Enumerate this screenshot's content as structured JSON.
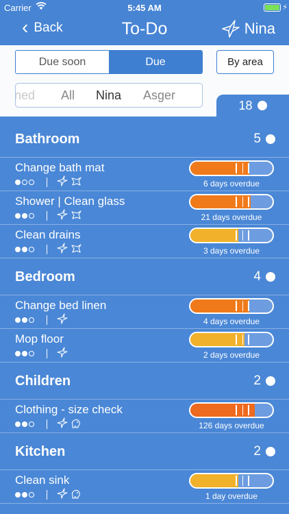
{
  "status": {
    "carrier": "Carrier",
    "time": "5:45 AM"
  },
  "nav": {
    "back_label": "Back",
    "title": "To-Do",
    "user_label": "Nina"
  },
  "filters": {
    "segments": [
      "Due soon",
      "Due"
    ],
    "active_segment": "Due",
    "area_button": "By area",
    "people": [
      "ned",
      "All",
      "Nina",
      "Asger"
    ],
    "selected_person": "Nina"
  },
  "total_count": "18",
  "colors": {
    "accent": "#3f7fd1",
    "background": "#4a87d6",
    "overdue_orange": "#f07a1a",
    "due_yellow": "#f2b12a"
  },
  "sections": [
    {
      "name": "Bathroom",
      "count": "5",
      "tasks": [
        {
          "title": "Change bath mat",
          "priority": 1,
          "assignees": [
            "bird-icon",
            "fox-icon"
          ],
          "overdue": "6 days overdue",
          "progress": 0.72,
          "color": "#f07a1a"
        },
        {
          "title": "Shower | Clean glass",
          "priority": 2,
          "assignees": [
            "bird-icon",
            "fox-icon"
          ],
          "overdue": "21 days overdue",
          "progress": 0.73,
          "color": "#f07a1a"
        },
        {
          "title": "Clean drains",
          "priority": 2,
          "assignees": [
            "bird-icon",
            "fox-icon"
          ],
          "overdue": "3 days overdue",
          "progress": 0.58,
          "color": "#f2b12a"
        }
      ]
    },
    {
      "name": "Bedroom",
      "count": "4",
      "tasks": [
        {
          "title": "Change bed linen",
          "priority": 2,
          "assignees": [
            "bird-icon"
          ],
          "overdue": "4 days overdue",
          "progress": 0.72,
          "color": "#f07a1a"
        },
        {
          "title": "Mop floor",
          "priority": 2,
          "assignees": [
            "bird-icon"
          ],
          "overdue": "2 days overdue",
          "progress": 0.66,
          "color": "#f2b12a"
        }
      ]
    },
    {
      "name": "Children",
      "count": "2",
      "tasks": [
        {
          "title": "Clothing - size check",
          "priority": 2,
          "assignees": [
            "bird-icon",
            "elephant-icon"
          ],
          "overdue": "126 days overdue",
          "progress": 0.78,
          "color": "#ee6a1e"
        }
      ]
    },
    {
      "name": "Kitchen",
      "count": "2",
      "tasks": [
        {
          "title": "Clean sink",
          "priority": 2,
          "assignees": [
            "bird-icon",
            "elephant-icon"
          ],
          "overdue": "1 day overdue",
          "progress": 0.58,
          "color": "#f2b12a"
        }
      ]
    }
  ]
}
